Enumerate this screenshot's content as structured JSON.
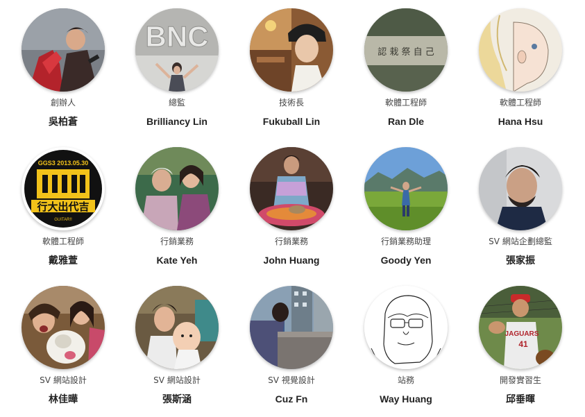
{
  "members": [
    {
      "role": "創辦人",
      "name": "吳柏蒼",
      "avatar": "photo-singer"
    },
    {
      "role": "總監",
      "name": "Brilliancy Lin",
      "avatar": "photo-bnc-sign"
    },
    {
      "role": "技術長",
      "name": "Fukuball Lin",
      "avatar": "photo-cafe-selfie"
    },
    {
      "role": "軟體工程師",
      "name": "Ran Dle",
      "avatar": "photo-stone-inscription",
      "inscription": "認 栽 祭 自 己"
    },
    {
      "role": "軟體工程師",
      "name": "Hana Hsu",
      "avatar": "drawing-girl-profile"
    },
    {
      "role": "軟體工程師",
      "name": "戴雅萱",
      "avatar": "badge-logo",
      "badge_top": "GGS3 2013.05.30",
      "badge_main": "行大出代吉",
      "badge_bottom": "GUITAR!!"
    },
    {
      "role": "行銷業務",
      "name": "Kate Yeh",
      "avatar": "photo-two-women"
    },
    {
      "role": "行銷業務",
      "name": "John Huang",
      "avatar": "photo-man-with-cat"
    },
    {
      "role": "行銷業務助理",
      "name": "Goody Yen",
      "avatar": "photo-field-landscape"
    },
    {
      "role": "SV 網站企劃總監",
      "name": "張家振",
      "avatar": "photo-man-portrait"
    },
    {
      "role": "SV 網站設計",
      "name": "林佳曄",
      "avatar": "photo-girls-with-dog"
    },
    {
      "role": "SV 網站設計",
      "name": "張斯涵",
      "avatar": "photo-woman-with-baby"
    },
    {
      "role": "SV 視覺設計",
      "name": "Cuz Fn",
      "avatar": "photo-rooftop-city"
    },
    {
      "role": "站務",
      "name": "Way Huang",
      "avatar": "drawing-man-glasses"
    },
    {
      "role": "開發實習生",
      "name": "邱垂暉",
      "avatar": "photo-baseball-boy",
      "jersey": "JAGUARS",
      "jersey_number": "41"
    }
  ]
}
